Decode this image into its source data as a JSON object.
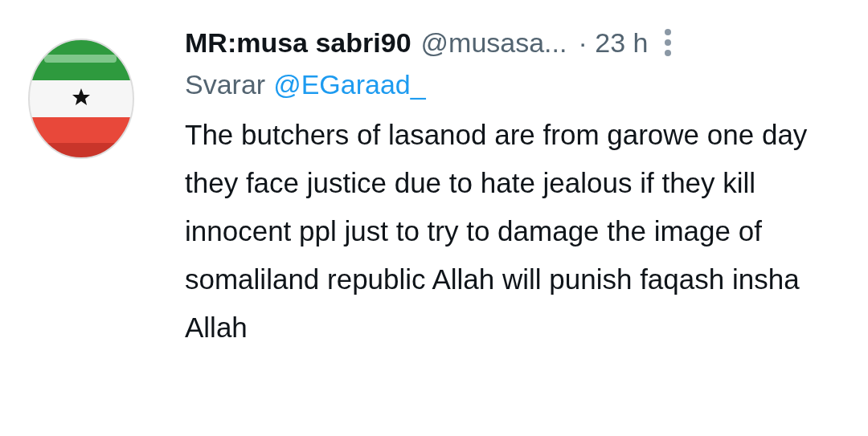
{
  "tweet": {
    "author_name": "MR:musa sabri90",
    "handle": "@musasa...",
    "time": "· 23 h",
    "reply_label": "Svarar",
    "reply_handle": "@EGaraad_",
    "text": "The butchers of lasanod are from garowe one day they face justice due to hate jealous if they kill innocent ppl just to try to damage the image of somaliland republic Allah will punish faqash insha Allah"
  }
}
